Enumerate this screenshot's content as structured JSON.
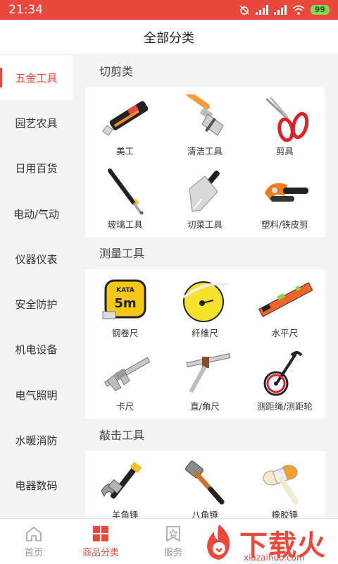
{
  "status": {
    "time": "21:34",
    "battery": "99"
  },
  "header": {
    "title": "全部分类"
  },
  "sidebar": {
    "items": [
      {
        "label": "五金工具",
        "active": true
      },
      {
        "label": "园艺农具"
      },
      {
        "label": "日用百货"
      },
      {
        "label": "电动/气动"
      },
      {
        "label": "仪器仪表"
      },
      {
        "label": "安全防护"
      },
      {
        "label": "机电设备"
      },
      {
        "label": "电气照明"
      },
      {
        "label": "水暖消防"
      },
      {
        "label": "电器数码"
      }
    ]
  },
  "sections": [
    {
      "title": "切剪类",
      "items": [
        {
          "label": "美工",
          "icon": "utility-knife-icon"
        },
        {
          "label": "清洁工具",
          "icon": "scraper-icon"
        },
        {
          "label": "剪具",
          "icon": "scissors-icon"
        },
        {
          "label": "玻璃工具",
          "icon": "glass-cutter-icon"
        },
        {
          "label": "切菜工具",
          "icon": "cleaver-icon"
        },
        {
          "label": "塑料/铁皮剪",
          "icon": "pipe-cutter-icon"
        }
      ]
    },
    {
      "title": "测量工具",
      "items": [
        {
          "label": "钢卷尺",
          "icon": "tape-measure-icon",
          "badge": "KATA",
          "sub": "5m"
        },
        {
          "label": "纤维尺",
          "icon": "fiber-tape-icon"
        },
        {
          "label": "水平尺",
          "icon": "spirit-level-icon"
        },
        {
          "label": "卡尺",
          "icon": "caliper-icon"
        },
        {
          "label": "直/角尺",
          "icon": "square-ruler-icon"
        },
        {
          "label": "测距绳/测距轮",
          "icon": "measuring-wheel-icon"
        }
      ]
    },
    {
      "title": "敲击工具",
      "items": [
        {
          "label": "羊角锤",
          "icon": "claw-hammer-icon"
        },
        {
          "label": "八角锤",
          "icon": "sledge-hammer-icon"
        },
        {
          "label": "橡胶锤",
          "icon": "rubber-mallet-icon"
        }
      ]
    }
  ],
  "tabbar": {
    "items": [
      {
        "label": "首页",
        "icon": "home-icon"
      },
      {
        "label": "商品分类",
        "icon": "category-icon",
        "active": true
      },
      {
        "label": "服务",
        "icon": "service-icon"
      }
    ]
  },
  "watermark": {
    "text": "下载火",
    "url": "xiazaihuo.com"
  },
  "colors": {
    "accent": "#e9483d",
    "background": "#f4f4f4"
  }
}
